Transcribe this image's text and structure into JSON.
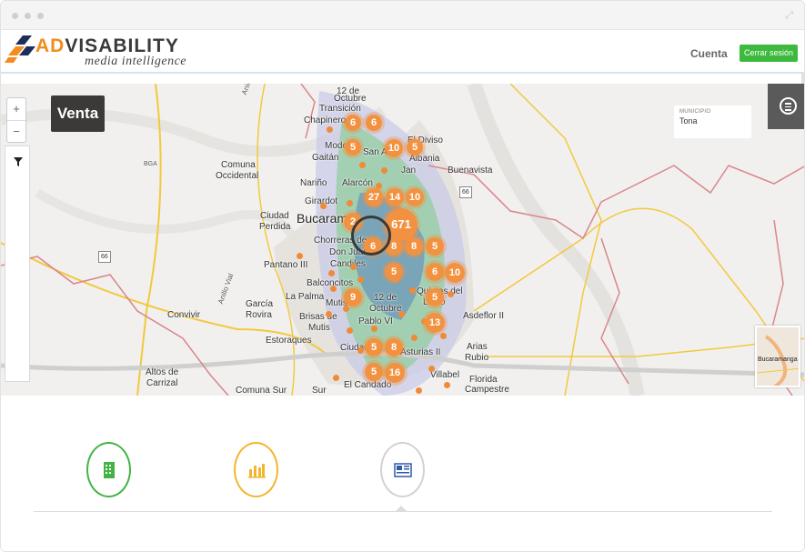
{
  "header": {
    "logo_ad": "AD",
    "logo_rest": "VISABILITY",
    "logo_sub": "media intelligence",
    "account_label": "Cuenta",
    "logout_label": "Cerrar sesión",
    "logout_color": "#3dba3d"
  },
  "map": {
    "mode_label": "Venta",
    "zoom_in": "+",
    "zoom_out": "−",
    "municipio_label": "MUNICIPIO",
    "municipio_value": "Tona",
    "minimap_label": "Bucaramanga",
    "places": {
      "octubre_12_top": "12 de",
      "octubre_top": "Octubre",
      "transicion": "Transición",
      "chapinero": "Chapinero",
      "el_diviso": "El Diviso",
      "albania": "Albania",
      "mode": "Mode",
      "gaitan": "Gaitán",
      "san_a": "San A",
      "buenavista": "Buenavista",
      "alarcon": "Alarcón",
      "jan": "Jan",
      "narino": "Nariño",
      "girardot": "Girardot",
      "comuna_occidental_1": "Comuna",
      "comuna_occidental_2": "Occidental",
      "ciudad_perdida_1": "Ciudad",
      "ciudad_perdida_2": "Perdida",
      "bucaramanga": "Bucaram",
      "chorreras": "Chorreras de",
      "don_juan": "Don Juan",
      "candiles": "Candiles",
      "pantano": "Pantano III",
      "balconcitos": "Balconcitos",
      "la_palma": "La Palma",
      "mutis": "Mutis",
      "octubre_12_mid": "12 de",
      "octubre_mid": "Octubre",
      "garcia_rovira_1": "García",
      "garcia_rovira_2": "Rovira",
      "convivir": "Convivir",
      "brisas_1": "Brisas de",
      "brisas_2": "Mutis",
      "pablo_vi": "Pablo VI",
      "quintas_1": "Quintas del",
      "quintas_2": "Llano",
      "asdeflor": "Asdeflor II",
      "estoraques": "Estoraques",
      "ciudad": "Ciudad",
      "asturias": "Asturias II",
      "arias_rubio_1": "Arias",
      "arias_rubio_2": "Rubio",
      "altos_1": "Altos de",
      "altos_2": "Carrizal",
      "villabel": "Villabel",
      "florida_1": "Florida",
      "florida_2": "Campestre",
      "el_candado": "El Candado",
      "comuna_sur": "Comuna Sur",
      "sur": "Sur",
      "anillo_vial_1": "Anillo Vial",
      "anillo_vial_2": "Anillo Vial",
      "road_66a": "66",
      "road_66b": "66",
      "bga": "BGA"
    },
    "clusters": [
      {
        "label": "6"
      },
      {
        "label": "6"
      },
      {
        "label": "5"
      },
      {
        "label": "10"
      },
      {
        "label": "5"
      },
      {
        "label": "27"
      },
      {
        "label": "14"
      },
      {
        "label": "10"
      },
      {
        "label": "671"
      },
      {
        "label": "2"
      },
      {
        "label": "6"
      },
      {
        "label": "8"
      },
      {
        "label": "8"
      },
      {
        "label": "5"
      },
      {
        "label": "5"
      },
      {
        "label": "6"
      },
      {
        "label": "10"
      },
      {
        "label": "9"
      },
      {
        "label": "5"
      },
      {
        "label": "13"
      },
      {
        "label": "5"
      },
      {
        "label": "8"
      },
      {
        "label": "5"
      },
      {
        "label": "16"
      }
    ]
  },
  "tabs": [
    {
      "name": "building",
      "color": "#43b443"
    },
    {
      "name": "bar-chart",
      "color": "#f4b52a"
    },
    {
      "name": "newspaper",
      "color": "#2f5aa8"
    }
  ]
}
